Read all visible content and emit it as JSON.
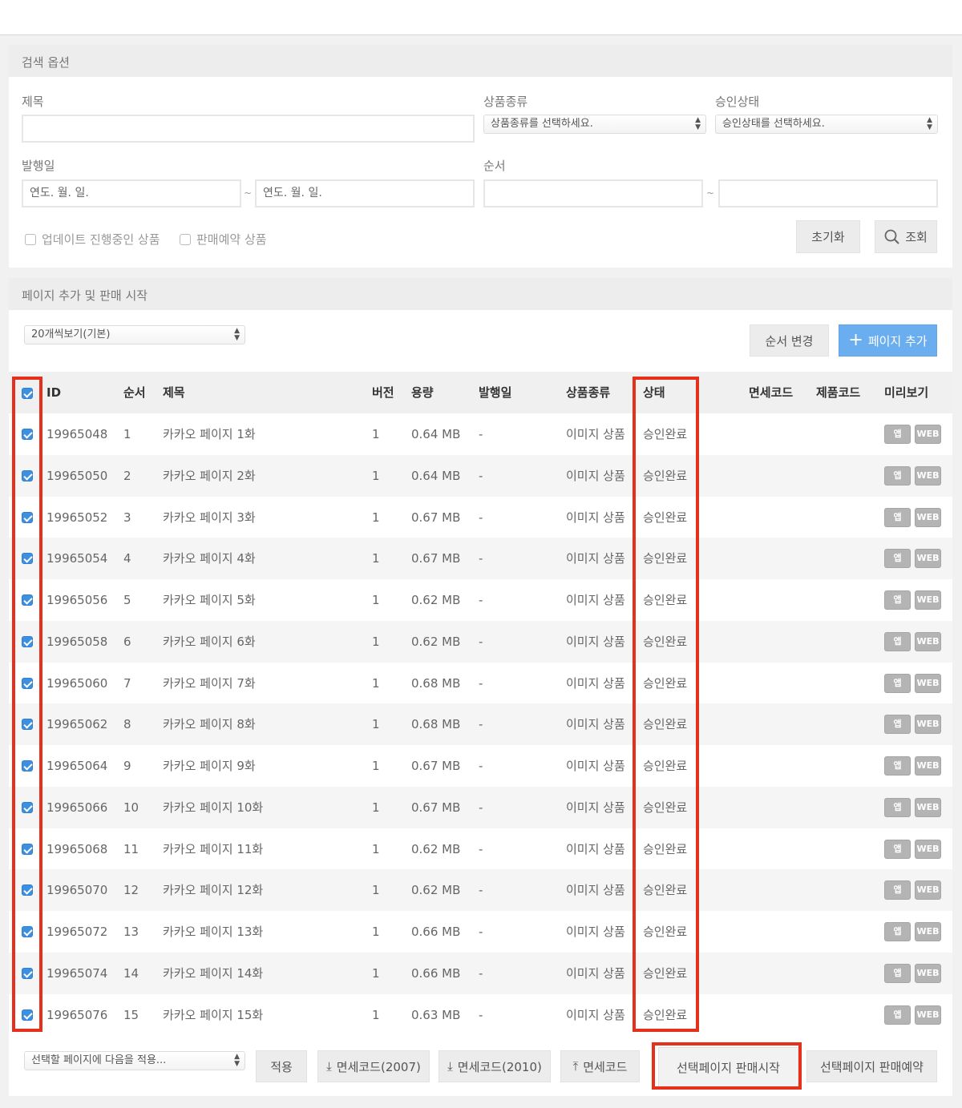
{
  "search": {
    "title": "검색 옵션",
    "title_label": "제목",
    "product_type_label": "상품종류",
    "product_type_placeholder": "상품종류를 선택하세요.",
    "approval_label": "승인상태",
    "approval_placeholder": "승인상태를 선택하세요.",
    "pubdate_label": "발행일",
    "date_placeholder": "연도. 월. 일.",
    "tilde": "~",
    "order_label": "순서",
    "opt_updating": "업데이트 진행중인 상품",
    "opt_reserved": "판매예약 상품",
    "reset_button": "초기화",
    "search_button": "조회"
  },
  "pages": {
    "title": "페이지 추가 및 판매 시작",
    "per_page": "20개씩보기(기본)",
    "reorder_button": "순서 변경",
    "add_button": "페이지 추가"
  },
  "table": {
    "headers": {
      "id": "ID",
      "order": "순서",
      "title": "제목",
      "version": "버전",
      "size": "용량",
      "pubdate": "발행일",
      "type": "상품종류",
      "status": "상태",
      "duty": "면세코드",
      "product": "제품코드",
      "preview": "미리보기"
    },
    "app_label": "앱",
    "web_label": "WEB",
    "rows": [
      {
        "id": "19965048",
        "order": "1",
        "title": "카카오 페이지 1화",
        "version": "1",
        "size": "0.64 MB",
        "pubdate": "-",
        "type": "이미지 상품",
        "status": "승인완료"
      },
      {
        "id": "19965050",
        "order": "2",
        "title": "카카오 페이지 2화",
        "version": "1",
        "size": "0.64 MB",
        "pubdate": "-",
        "type": "이미지 상품",
        "status": "승인완료"
      },
      {
        "id": "19965052",
        "order": "3",
        "title": "카카오 페이지 3화",
        "version": "1",
        "size": "0.67 MB",
        "pubdate": "-",
        "type": "이미지 상품",
        "status": "승인완료"
      },
      {
        "id": "19965054",
        "order": "4",
        "title": "카카오 페이지 4화",
        "version": "1",
        "size": "0.67 MB",
        "pubdate": "-",
        "type": "이미지 상품",
        "status": "승인완료"
      },
      {
        "id": "19965056",
        "order": "5",
        "title": "카카오 페이지 5화",
        "version": "1",
        "size": "0.62 MB",
        "pubdate": "-",
        "type": "이미지 상품",
        "status": "승인완료"
      },
      {
        "id": "19965058",
        "order": "6",
        "title": "카카오 페이지 6화",
        "version": "1",
        "size": "0.62 MB",
        "pubdate": "-",
        "type": "이미지 상품",
        "status": "승인완료"
      },
      {
        "id": "19965060",
        "order": "7",
        "title": "카카오 페이지 7화",
        "version": "1",
        "size": "0.68 MB",
        "pubdate": "-",
        "type": "이미지 상품",
        "status": "승인완료"
      },
      {
        "id": "19965062",
        "order": "8",
        "title": "카카오 페이지 8화",
        "version": "1",
        "size": "0.68 MB",
        "pubdate": "-",
        "type": "이미지 상품",
        "status": "승인완료"
      },
      {
        "id": "19965064",
        "order": "9",
        "title": "카카오 페이지 9화",
        "version": "1",
        "size": "0.67 MB",
        "pubdate": "-",
        "type": "이미지 상품",
        "status": "승인완료"
      },
      {
        "id": "19965066",
        "order": "10",
        "title": "카카오 페이지 10화",
        "version": "1",
        "size": "0.67 MB",
        "pubdate": "-",
        "type": "이미지 상품",
        "status": "승인완료"
      },
      {
        "id": "19965068",
        "order": "11",
        "title": "카카오 페이지 11화",
        "version": "1",
        "size": "0.62 MB",
        "pubdate": "-",
        "type": "이미지 상품",
        "status": "승인완료"
      },
      {
        "id": "19965070",
        "order": "12",
        "title": "카카오 페이지 12화",
        "version": "1",
        "size": "0.62 MB",
        "pubdate": "-",
        "type": "이미지 상품",
        "status": "승인완료"
      },
      {
        "id": "19965072",
        "order": "13",
        "title": "카카오 페이지 13화",
        "version": "1",
        "size": "0.66 MB",
        "pubdate": "-",
        "type": "이미지 상품",
        "status": "승인완료"
      },
      {
        "id": "19965074",
        "order": "14",
        "title": "카카오 페이지 14화",
        "version": "1",
        "size": "0.66 MB",
        "pubdate": "-",
        "type": "이미지 상품",
        "status": "승인완료"
      },
      {
        "id": "19965076",
        "order": "15",
        "title": "카카오 페이지 15화",
        "version": "1",
        "size": "0.63 MB",
        "pubdate": "-",
        "type": "이미지 상품",
        "status": "승인완료"
      }
    ]
  },
  "footer": {
    "apply_select": "선택할 페이지에 다음을 적용...",
    "apply_button": "적용",
    "duty2007_button": "면세코드(2007)",
    "duty2010_button": "면세코드(2010)",
    "duty_upload_button": "면세코드",
    "start_sale_button": "선택페이지 판매시작",
    "reserve_sale_button": "선택페이지 판매예약"
  },
  "colors": {
    "highlight": "#e5311c",
    "accent_blue": "#6aaef0",
    "checkbox": "#3d8fe0"
  }
}
